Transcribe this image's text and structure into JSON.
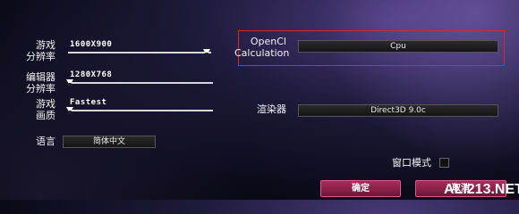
{
  "left": {
    "game_resolution": {
      "label_line1": "游戏",
      "label_line2": "分辨率",
      "value": "1600X900",
      "level": 0.97
    },
    "editor_resolution": {
      "label_line1": "编辑器",
      "label_line2": "分辨率",
      "value": "1280X768",
      "level": 0.0
    },
    "game_quality": {
      "label_line1": "游戏",
      "label_line2": "画质",
      "value": "Fastest",
      "level": 0.0
    },
    "language": {
      "label": "语言",
      "value": "简体中文"
    }
  },
  "right": {
    "opencl": {
      "label_line1": "OpenCl",
      "label_line2": "Calculation",
      "value": "Cpu"
    },
    "renderer": {
      "label": "渲染器",
      "value": "Direct3D 9.0c"
    },
    "windowed": {
      "label": "窗口模式",
      "checked": false
    }
  },
  "buttons": {
    "ok": "确定",
    "cancel": "取消"
  },
  "watermark": "ALI213.NET",
  "colors": {
    "highlight": "#d8282e",
    "button": "#8a2046"
  }
}
